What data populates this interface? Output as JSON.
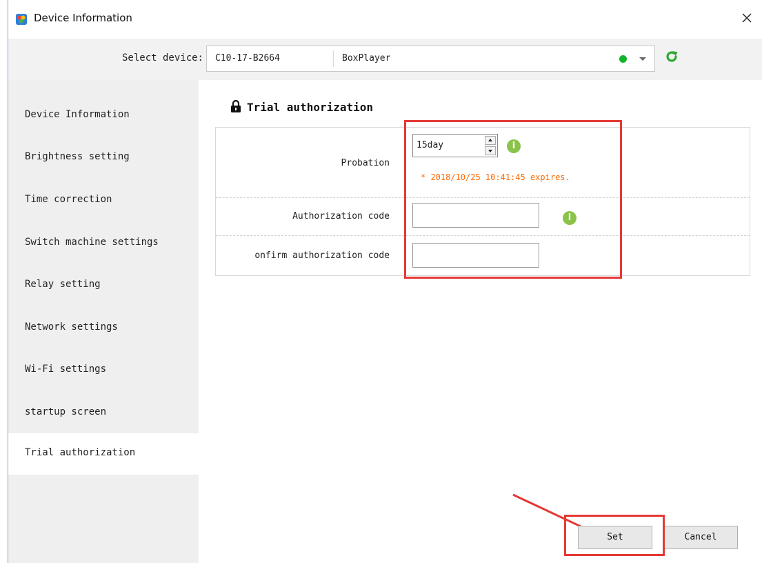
{
  "window": {
    "title": "Device Information"
  },
  "toolbar": {
    "select_label": "Select device:",
    "device_id": "C10-17-B2664",
    "device_name": "BoxPlayer",
    "status_color": "#12b42a"
  },
  "sidebar": {
    "items": [
      {
        "label": "Device Information"
      },
      {
        "label": "Brightness setting"
      },
      {
        "label": "Time correction"
      },
      {
        "label": "Switch machine settings"
      },
      {
        "label": "Relay setting"
      },
      {
        "label": "Network settings"
      },
      {
        "label": "Wi-Fi settings"
      },
      {
        "label": "startup screen"
      },
      {
        "label": "Trial authorization"
      }
    ],
    "active_index": 8
  },
  "main": {
    "section_title": "Trial authorization",
    "probation": {
      "label": "Probation",
      "value": "15day",
      "expires_note": "* 2018/10/25 10:41:45 expires."
    },
    "authorization_code": {
      "label": "Authorization code",
      "value": ""
    },
    "confirm_authorization_code": {
      "label": "onfirm authorization code",
      "value": ""
    }
  },
  "buttons": {
    "set": "Set",
    "cancel": "Cancel"
  },
  "colors": {
    "accent_red": "#e53935",
    "info_green": "#8bc34a",
    "expires_orange": "#ff6a00",
    "refresh_green": "#2fa82f"
  },
  "icons": {
    "app": "app-icon",
    "close": "close-icon",
    "refresh": "refresh-icon",
    "lock": "lock-icon",
    "info": "info-icon",
    "dropdown": "chevron-down-icon"
  }
}
